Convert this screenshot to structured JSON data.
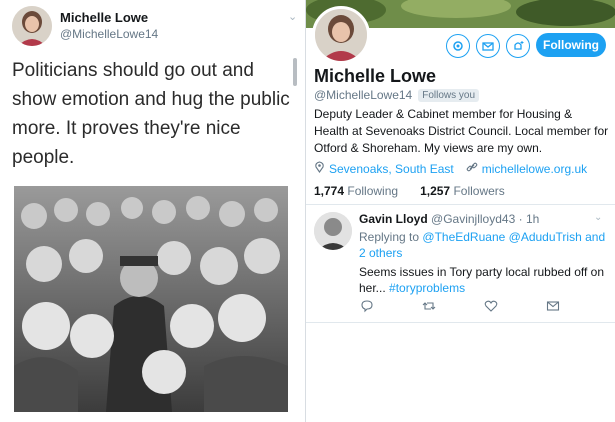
{
  "left_tweet": {
    "author_name": "Michelle Lowe",
    "author_handle": "@MichelleLowe14",
    "text": "Politicians should go out and show emotion and hug the public more. It proves they're nice people."
  },
  "profile": {
    "name": "Michelle Lowe",
    "handle": "@MichelleLowe14",
    "follows_you": "Follows you",
    "follow_button": "Following",
    "bio": "Deputy Leader & Cabinet member for Housing & Health at Sevenoaks District Council. Local member for Otford & Shoreham. My views are my own.",
    "location": "Sevenoaks, South East",
    "website": "michellelowe.org.uk",
    "following_count": "1,774",
    "following_label": "Following",
    "followers_count": "1,257",
    "followers_label": "Followers"
  },
  "reply": {
    "author_name": "Gavin Lloyd",
    "author_handle": "@Gavinjlloyd43",
    "time": "· 1h",
    "replying_prefix": "Replying to",
    "reply_to_1": "@TheEdRuane",
    "reply_to_2": "@AduduTrish",
    "reply_to_more": "and 2 others",
    "text": "Seems issues in Tory party local rubbed off on her...",
    "hashtag": "#toryproblems"
  },
  "colors": {
    "accent": "#1da1f2",
    "secondary_text": "#657786"
  },
  "icons": [
    "chevron-down-icon",
    "settings-icon",
    "message-icon",
    "notification-add-icon",
    "location-icon",
    "link-icon",
    "reply-icon",
    "retweet-icon",
    "like-icon",
    "dm-icon"
  ]
}
